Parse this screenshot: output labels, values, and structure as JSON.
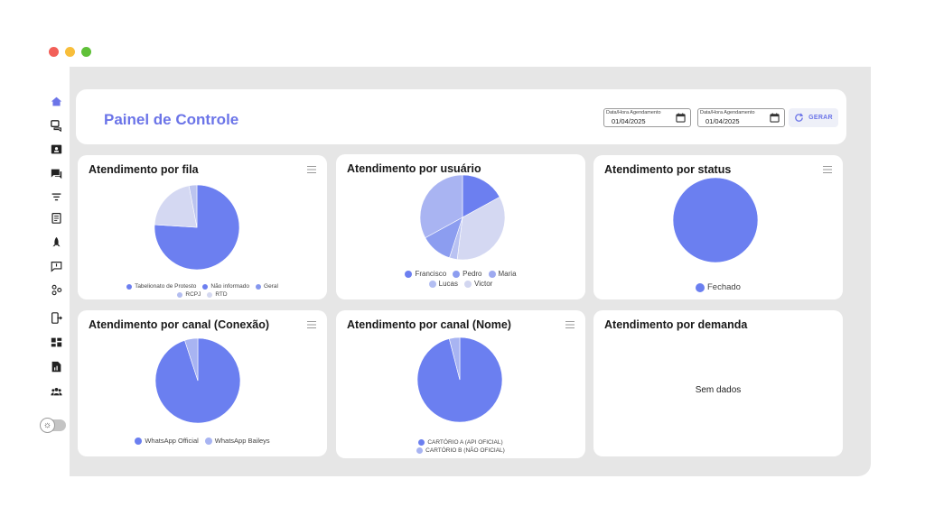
{
  "window": {
    "controls": [
      "close",
      "minimize",
      "maximize"
    ]
  },
  "sidebar": {
    "items": [
      {
        "icon": "home-icon"
      },
      {
        "icon": "chat-bubbles-icon"
      },
      {
        "icon": "contact-card-icon"
      },
      {
        "icon": "messages-icon"
      },
      {
        "icon": "filter-icon"
      },
      {
        "icon": "clipboard-icon"
      },
      {
        "icon": "rocket-icon"
      },
      {
        "icon": "feedback-icon"
      },
      {
        "icon": "flow-icon"
      },
      {
        "icon": "device-exit-icon"
      },
      {
        "icon": "dashboard-grid-icon"
      },
      {
        "icon": "report-icon"
      },
      {
        "icon": "group-icon"
      }
    ],
    "theme_toggle": {
      "icon": "sun-icon",
      "glyph": "☼"
    }
  },
  "header": {
    "title": "Painel de Controle",
    "date_start": {
      "label": "Data/Hora Agendamento",
      "value": "01/04/2025"
    },
    "date_end": {
      "label": "Data/Hora Agendamento",
      "value": "01/04/2025"
    },
    "generate_label": "GERAR"
  },
  "colors": {
    "accent": "#6b74e8",
    "primary": "#6b7ff0"
  },
  "cards": {
    "fila": {
      "title": "Atendimento por fila"
    },
    "usuario": {
      "title": "Atendimento por usuário"
    },
    "status": {
      "title": "Atendimento por status"
    },
    "canal_conexao": {
      "title": "Atendimento por canal (Conexão)"
    },
    "canal_nome": {
      "title": "Atendimento por canal (Nome)"
    },
    "demanda": {
      "title": "Atendimento por demanda",
      "empty": "Sem dados"
    }
  },
  "chart_data": [
    {
      "id": "fila",
      "type": "pie",
      "start_deg": 0,
      "categories": [
        "Tabelionato de Protesto",
        "Não informado",
        "Geral",
        "RCPJ",
        "RTD"
      ],
      "values": [
        0,
        76,
        0,
        21,
        3
      ],
      "colors": [
        "#6c7ff0",
        "#6c7ff0",
        "#8597ee",
        "#b3bdf0",
        "#d4d8f0"
      ],
      "slice_colors": [
        "#6c7ff0",
        "#6c7ff0",
        "#8597ee",
        "#d4d8f2",
        "#bcc4ef"
      ]
    },
    {
      "id": "usuario",
      "type": "pie",
      "start_deg": 0,
      "categories": [
        "Francisco",
        "Pedro",
        "Maria",
        "Lucas",
        "Victor"
      ],
      "values": [
        17,
        0,
        0,
        0,
        0
      ],
      "colors": [
        "#6c7ff0",
        "#8c9df0",
        "#9eaaf0",
        "#b3bef2",
        "#d2d6f0"
      ],
      "slices": [
        {
          "value": 17,
          "color": "#6c7ff0"
        },
        {
          "value": 35,
          "color": "#d4d8f2"
        },
        {
          "value": 3,
          "color": "#b9c2f2"
        },
        {
          "value": 12,
          "color": "#8c9df0"
        },
        {
          "value": 33,
          "color": "#a9b4f2"
        }
      ]
    },
    {
      "id": "status",
      "type": "pie",
      "start_deg": 0,
      "categories": [
        "Fechado"
      ],
      "values": [
        100
      ],
      "colors": [
        "#6b7ff0"
      ]
    },
    {
      "id": "canal_conexao",
      "type": "pie",
      "start_deg": 0,
      "categories": [
        "WhatsApp Official",
        "WhatsApp Baileys"
      ],
      "values": [
        95,
        5
      ],
      "colors": [
        "#6b7ff0",
        "#a8b4f2"
      ]
    },
    {
      "id": "canal_nome",
      "type": "pie",
      "start_deg": 0,
      "categories": [
        "CARTÓRIO A (API OFICIAL)",
        "CARTÓRIO B (NÃO OFICIAL)"
      ],
      "values": [
        96,
        4
      ],
      "colors": [
        "#6b7ff0",
        "#a8b4f2"
      ]
    }
  ]
}
